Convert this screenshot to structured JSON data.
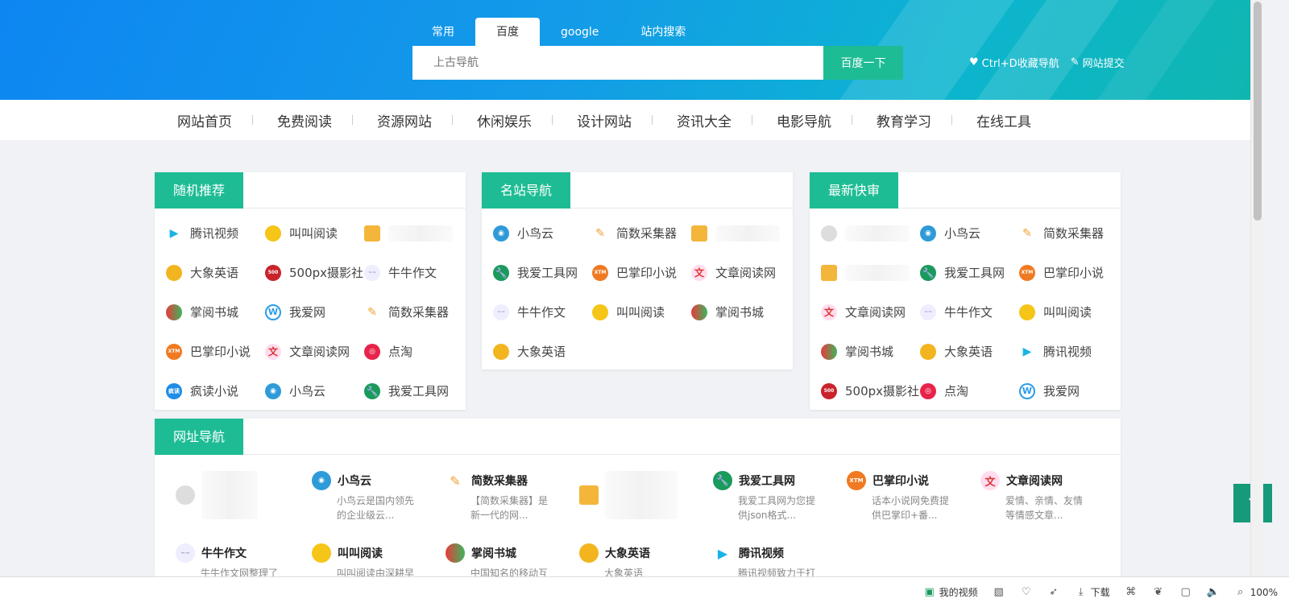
{
  "search": {
    "tabs": [
      "常用",
      "百度",
      "google",
      "站内搜索"
    ],
    "active_tab": "百度",
    "placeholder": "上古导航",
    "button": "百度一下"
  },
  "header_links": {
    "bookmark": "Ctrl+D收藏导航",
    "submit": "网站提交"
  },
  "nav": [
    "网站首页",
    "免费阅读",
    "资源网站",
    "休闲娱乐",
    "设计网站",
    "资讯大全",
    "电影导航",
    "教育学习",
    "在线工具"
  ],
  "cards": {
    "random": {
      "title": "随机推荐",
      "items": [
        "腾讯视频",
        "叫叫阅读",
        "",
        "大象英语",
        "500px摄影社区",
        "牛牛作文",
        "掌阅书城",
        "我爱网",
        "简数采集器",
        "巴掌印小说",
        "文章阅读网",
        "点淘",
        "疯读小说",
        "小鸟云",
        "我爱工具网"
      ]
    },
    "famous": {
      "title": "名站导航",
      "items": [
        "小鸟云",
        "简数采集器",
        "",
        "我爱工具网",
        "巴掌印小说",
        "文章阅读网",
        "牛牛作文",
        "叫叫阅读",
        "掌阅书城",
        "大象英语"
      ]
    },
    "latest": {
      "title": "最新快审",
      "items": [
        "",
        "小鸟云",
        "简数采集器",
        "",
        "我爱工具网",
        "巴掌印小说",
        "文章阅读网",
        "牛牛作文",
        "叫叫阅读",
        "掌阅书城",
        "大象英语",
        "腾讯视频",
        "500px摄影社区",
        "点淘",
        "我爱网"
      ]
    }
  },
  "directory": {
    "title": "网址导航",
    "items": [
      {
        "name": "",
        "desc": ""
      },
      {
        "name": "小鸟云",
        "desc": "小鸟云是国内领先的企业级云..."
      },
      {
        "name": "简数采集器",
        "desc": "【简数采集器】是新一代的网..."
      },
      {
        "name": "",
        "desc": ""
      },
      {
        "name": "我爱工具网",
        "desc": "我爱工具网为您提供json格式..."
      },
      {
        "name": "巴掌印小说",
        "desc": "话本小说网免费提供巴掌印+番..."
      },
      {
        "name": "文章阅读网",
        "desc": "爱情、亲情、友情等情感文章..."
      },
      {
        "name": "牛牛作文",
        "desc": "牛牛作文网整理了一年级,二年..."
      },
      {
        "name": "叫叫阅读",
        "desc": "叫叫阅读由深耕早教和绘本行..."
      },
      {
        "name": "掌阅书城",
        "desc": "中国知名的移动互联网阅读书..."
      },
      {
        "name": "大象英语",
        "desc": "大象英语(Elephant..."
      },
      {
        "name": "腾讯视频",
        "desc": "腾讯视频致力于打造中国领先..."
      }
    ]
  },
  "back_to_top": "↑",
  "statusbar": {
    "video": "我的视频",
    "download": "下载",
    "zoom": "100%"
  }
}
